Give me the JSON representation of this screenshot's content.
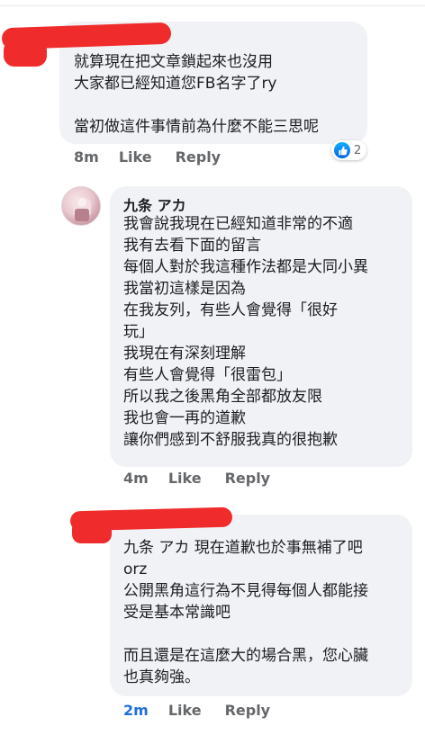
{
  "comments": [
    {
      "text": "就算現在把文章鎖起來也沒用\n大家都已經知道您FB名字了ry\n\n當初做這件事情前為什麼不能三思呢",
      "time": "8m",
      "like_label": "Like",
      "reply_label": "Reply",
      "reaction_icon": "like-icon",
      "reaction_count": "2"
    },
    {
      "author": "九条 アカ",
      "text": "我會說我現在已經知道非常的不適\n我有去看下面的留言\n每個人對於我這種作法都是大同小異\n我當初這樣是因為\n在我友列，有些人會覺得「很好\n玩」\n我現在有深刻理解\n有些人會覺得「很雷包」\n所以我之後黑角全部都放友限\n我也會一再的道歉\n讓你們感到不舒服我真的很抱歉",
      "time": "4m",
      "like_label": "Like",
      "reply_label": "Reply"
    },
    {
      "text": "九条 アカ 現在道歉也於事無補了吧\norz\n公開黑角這行為不見得每個人都能接\n受是基本常識吧\n\n而且還是在這麼大的場合黑，您心臟\n也真夠強。",
      "time": "2m",
      "like_label": "Like",
      "reply_label": "Reply"
    }
  ],
  "colors": {
    "bubble": "#f0f2f5",
    "meta": "#65676b",
    "recent_time": "#216fdb",
    "redaction": "#ef2b2b"
  }
}
